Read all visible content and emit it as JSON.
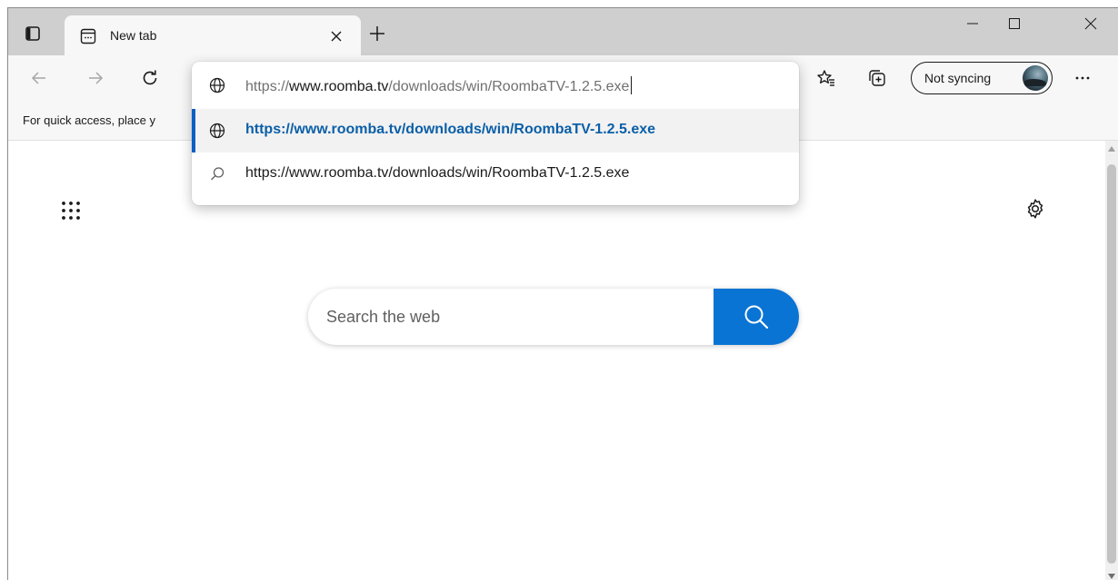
{
  "colors": {
    "accent": "#0a74d4",
    "selection_bar": "#0b5fc4",
    "selected_link": "#0b5fa8",
    "chrome": "#cfcfcf",
    "toolbar": "#f7f7f7"
  },
  "tabstrip": {
    "tab_actions_icon": "vertical-tabs-icon",
    "tab": {
      "title": "New tab",
      "favicon": "new-tab-page-icon"
    },
    "new_tab_icon": "plus-icon",
    "window_controls": [
      "minimize-icon",
      "maximize-icon",
      "close-icon"
    ]
  },
  "toolbar": {
    "back_icon": "back-arrow-icon",
    "forward_icon": "forward-arrow-icon",
    "refresh_icon": "refresh-icon",
    "favorites_icon": "favorites-icon",
    "collections_icon": "collections-icon",
    "profile": {
      "label": "Not syncing"
    },
    "more_icon": "more-icon"
  },
  "omnibox": {
    "input": {
      "scheme": "https://",
      "host": "www.roomba.tv",
      "path": "/downloads/win/RoombaTV-1.2.5.exe"
    },
    "suggestions": [
      {
        "type": "url",
        "text": "https://www.roomba.tv/downloads/win/RoombaTV-1.2.5.exe",
        "icon": "globe-icon",
        "selected": true
      },
      {
        "type": "search",
        "text": "https://www.roomba.tv/downloads/win/RoombaTV-1.2.5.exe",
        "icon": "search-icon",
        "selected": false
      }
    ]
  },
  "favorites_bar": {
    "text": "For quick access, place y"
  },
  "content": {
    "search": {
      "placeholder": "Search the web"
    },
    "apps_icon": "app-launcher-icon",
    "settings_icon": "gear-icon"
  }
}
